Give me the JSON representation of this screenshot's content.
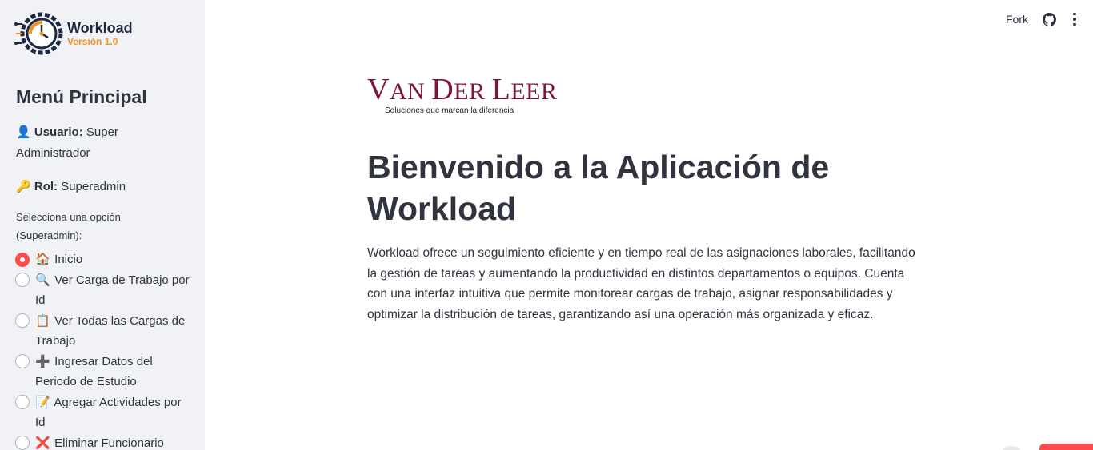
{
  "sidebar": {
    "logo": {
      "title": "Workload",
      "version": "Versión 1.0",
      "icon": "clock-gear-icon"
    },
    "menu_title": "Menú Principal",
    "user": {
      "icon": "person-icon",
      "label": "Usuario:",
      "value": "Super Administrador"
    },
    "role": {
      "icon": "key-icon",
      "label": "Rol:",
      "value": "Superadmin"
    },
    "select_label": "Selecciona una opción (Superadmin):",
    "options": [
      {
        "icon": "house-icon",
        "glyph": "🏠",
        "label": "Inicio",
        "selected": true
      },
      {
        "icon": "magnifier-icon",
        "glyph": "🔍",
        "label": "Ver Carga de Trabajo por Id",
        "selected": false
      },
      {
        "icon": "clipboard-icon",
        "glyph": "📋",
        "label": "Ver Todas las Cargas de Trabajo",
        "selected": false
      },
      {
        "icon": "plus-icon",
        "glyph": "➕",
        "label": "Ingresar Datos del Periodo de Estudio",
        "selected": false
      },
      {
        "icon": "memo-icon",
        "glyph": "📝",
        "label": "Agregar Actividades por Id",
        "selected": false
      },
      {
        "icon": "cross-mark-icon",
        "glyph": "❌",
        "label": "Eliminar Funcionario",
        "selected": false
      }
    ]
  },
  "topbar": {
    "fork_label": "Fork",
    "github_icon": "github-icon",
    "menu_icon": "kebab-menu-icon"
  },
  "main": {
    "brand": {
      "name_caps_1": "V",
      "name_rest_1": "AN ",
      "name_caps_2": "D",
      "name_rest_2": "ER ",
      "name_caps_3": "L",
      "name_rest_3": "EER",
      "tagline": "Soluciones que marcan la diferencia"
    },
    "title": "Bienvenido a la Aplicación de Workload",
    "description": "Workload ofrece un seguimiento eficiente y en tiempo real de las asignaciones laborales, facilitando la gestión de tareas y aumentando la productividad en distintos departamentos o equipos. Cuenta con una interfaz intuitiva que permite monitorear cargas de trabajo, asignar responsabilidades y optimizar la distribución de tareas, garantizando así una operación más organizada y eficaz."
  },
  "colors": {
    "accent": "#ff4b4b",
    "brand": "#7f1734",
    "logo_orange": "#f0921f",
    "logo_navy": "#1e2a44",
    "sidebar_bg": "#f0f2f6"
  }
}
